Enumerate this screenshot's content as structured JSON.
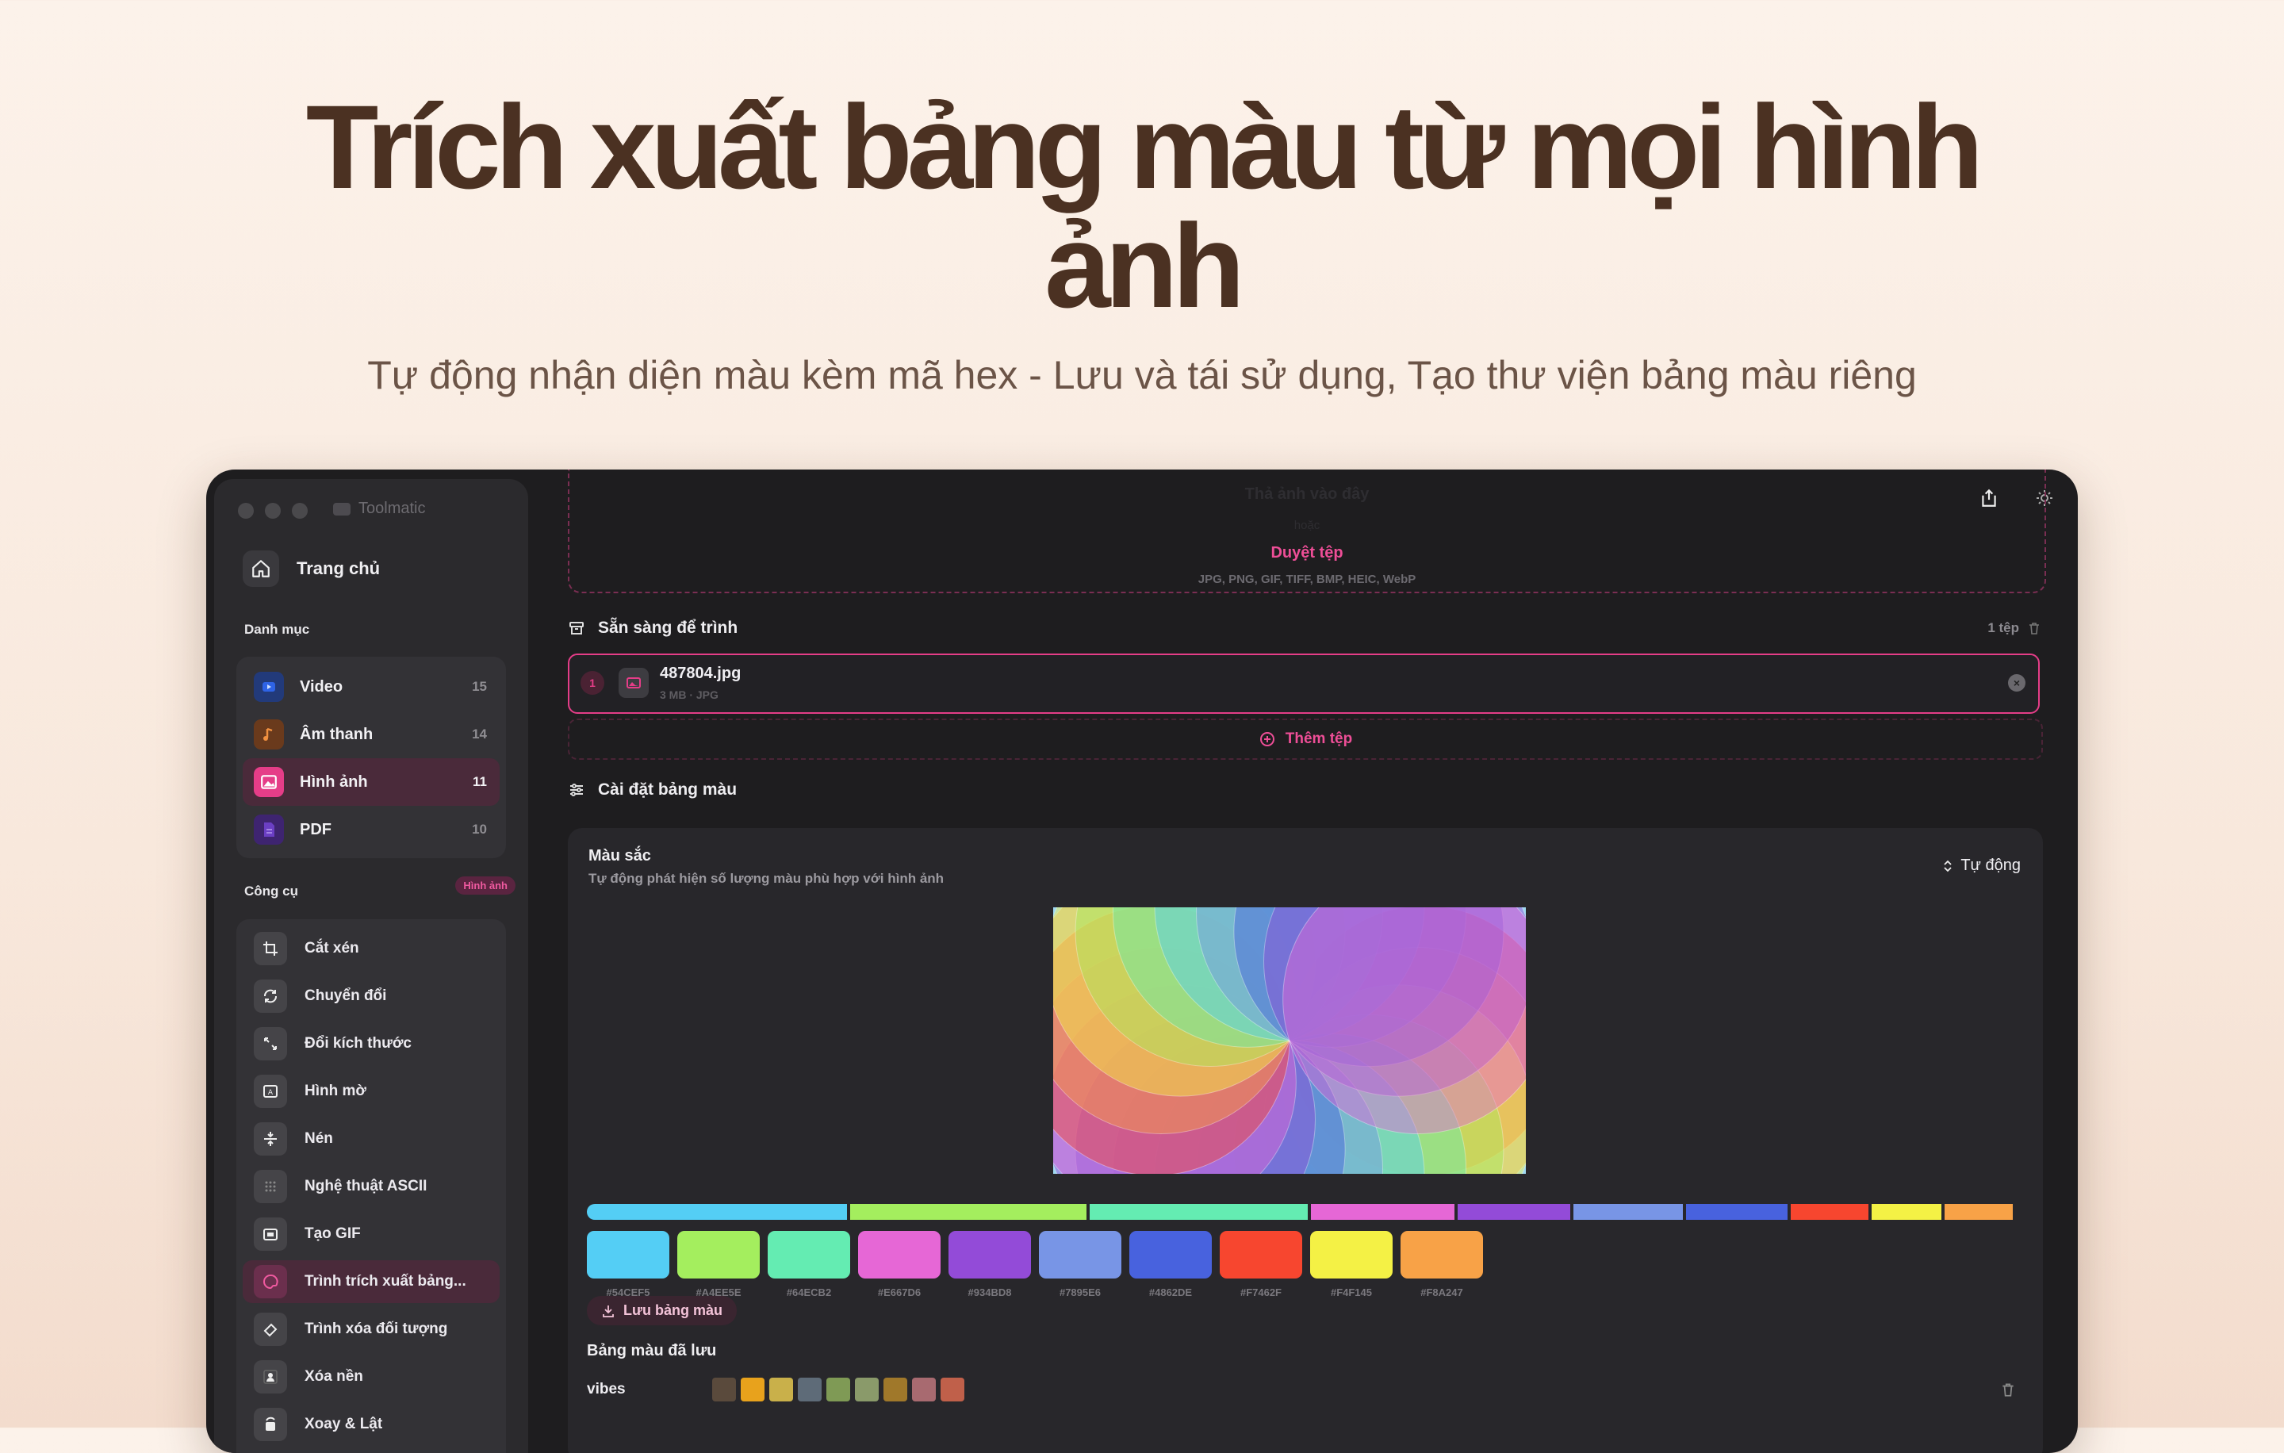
{
  "hero": {
    "title": "Trích xuất bảng màu từ mọi hình ảnh",
    "subtitle": "Tự động nhận diện màu kèm mã hex - Lưu và tái sử dụng, Tạo thư viện bảng màu riêng"
  },
  "app": {
    "name": "Toolmatic"
  },
  "sidebar": {
    "home_label": "Trang chủ",
    "categories_label": "Danh mục",
    "categories": [
      {
        "label": "Video",
        "count": "15",
        "color": "#2e63e6"
      },
      {
        "label": "Âm thanh",
        "count": "14",
        "color": "#e87a2c"
      },
      {
        "label": "Hình ảnh",
        "count": "11",
        "color": "#e53d88"
      },
      {
        "label": "PDF",
        "count": "10",
        "color": "#6b3fc4"
      }
    ],
    "tools_label": "Công cụ",
    "tools_badge": "Hình ảnh",
    "tools": [
      {
        "label": "Cắt xén"
      },
      {
        "label": "Chuyển đổi"
      },
      {
        "label": "Đổi kích thước"
      },
      {
        "label": "Hình mờ"
      },
      {
        "label": "Nén"
      },
      {
        "label": "Nghệ thuật ASCII"
      },
      {
        "label": "Tạo GIF"
      },
      {
        "label": "Trình trích xuất bảng..."
      },
      {
        "label": "Trình xóa đối tượng"
      },
      {
        "label": "Xóa nền"
      },
      {
        "label": "Xoay & Lật"
      }
    ]
  },
  "dropzone": {
    "ghost_title": "Thả ảnh vào đây",
    "ghost_or": "hoặc",
    "browse_label": "Duyệt tệp",
    "formats": "JPG, PNG, GIF, TIFF, BMP, HEIC, WebP"
  },
  "ready": {
    "title": "Sẵn sàng để trình",
    "count": "1 tệp",
    "file": {
      "index": "1",
      "name": "487804.jpg",
      "meta": "3 MB · JPG"
    },
    "add_label": "Thêm tệp"
  },
  "palette_settings": {
    "title": "Cài đặt bảng màu",
    "colors_title": "Màu sắc",
    "colors_desc": "Tự động phát hiện số lượng màu phù hợp với hình ảnh",
    "mode": "Tự động",
    "save_label": "Lưu bảng màu",
    "saved_title": "Bảng màu đã lưu"
  },
  "palette": [
    {
      "hex": "#54CEF5",
      "share": 0.185
    },
    {
      "hex": "#A4EE5E",
      "share": 0.168
    },
    {
      "hex": "#64ECB2",
      "share": 0.155
    },
    {
      "hex": "#E667D6",
      "share": 0.102
    },
    {
      "hex": "#934BD8",
      "share": 0.08
    },
    {
      "hex": "#7895E6",
      "share": 0.078
    },
    {
      "hex": "#4862DE",
      "share": 0.072
    },
    {
      "hex": "#F7462F",
      "share": 0.055
    },
    {
      "hex": "#F4F145",
      "share": 0.05
    },
    {
      "hex": "#F8A247",
      "share": 0.048
    }
  ],
  "saved_palettes": [
    {
      "name": "vibes",
      "colors": [
        "#5a4a3c",
        "#e8a21c",
        "#c9b04a",
        "#5e6b78",
        "#7f9a55",
        "#8a9a6a",
        "#a0782a",
        "#a86a70",
        "#c0604a"
      ]
    }
  ]
}
